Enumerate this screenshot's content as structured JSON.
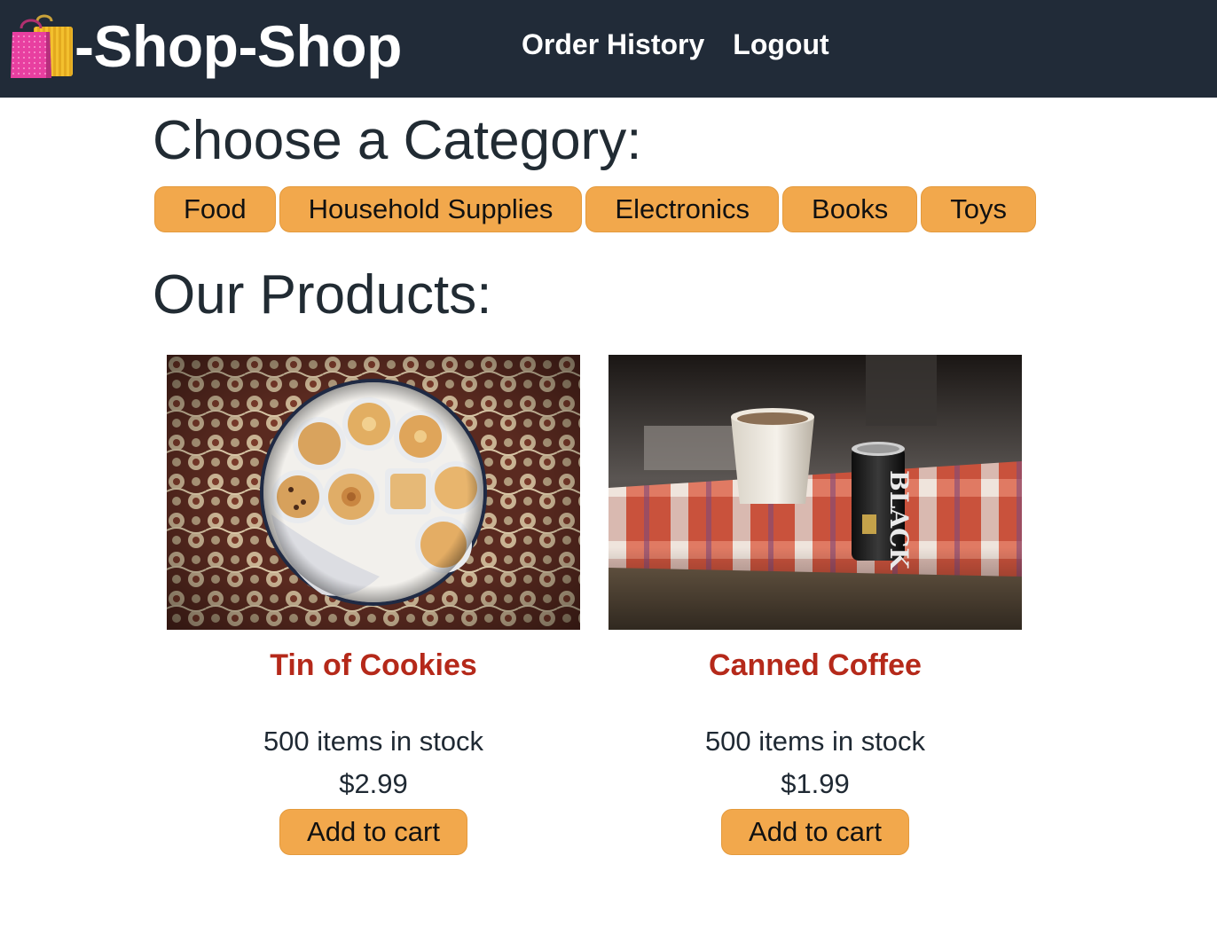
{
  "navbar": {
    "brand_icon": "shopping-bags-icon",
    "brand_text": "-Shop-Shop",
    "links": [
      {
        "label": "Order History"
      },
      {
        "label": "Logout"
      }
    ]
  },
  "categories": {
    "heading": "Choose a Category:",
    "items": [
      {
        "label": "Food"
      },
      {
        "label": "Household Supplies"
      },
      {
        "label": "Electronics"
      },
      {
        "label": "Books"
      },
      {
        "label": "Toys"
      }
    ]
  },
  "products": {
    "heading": "Our Products:",
    "items": [
      {
        "name": "Tin of Cookies",
        "stock": "500 items in stock",
        "price": "$2.99",
        "button": "Add to cart",
        "image": "cookie-tin-photo"
      },
      {
        "name": "Canned Coffee",
        "stock": "500 items in stock",
        "price": "$1.99",
        "button": "Add to cart",
        "image": "canned-coffee-photo"
      }
    ]
  },
  "colors": {
    "navbar_bg": "#212b38",
    "button_bg": "#f2a84c",
    "product_name": "#b5291a"
  }
}
